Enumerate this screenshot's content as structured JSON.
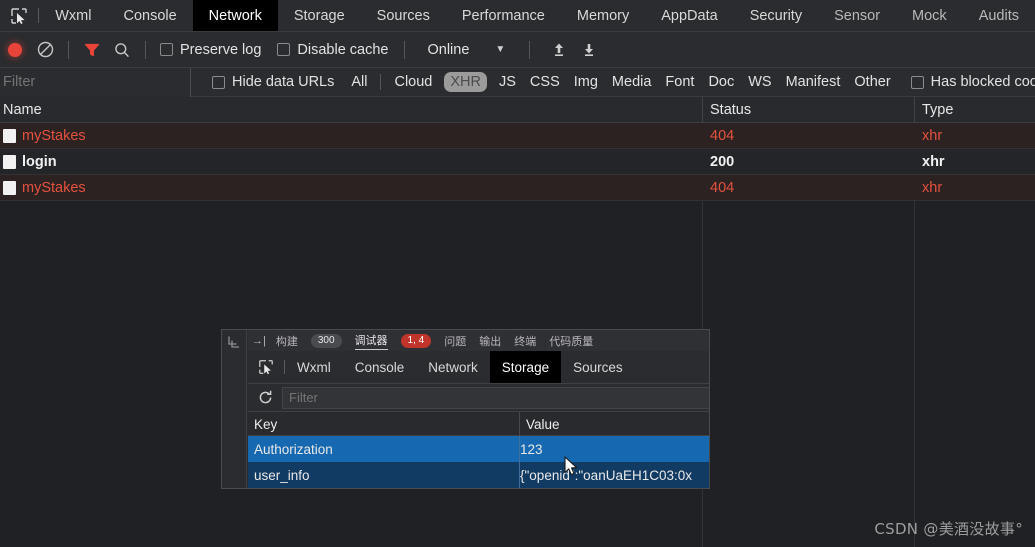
{
  "outer": {
    "inspect_icon": "inspect-element-icon",
    "tabs": [
      {
        "label": "Wxml",
        "active": false
      },
      {
        "label": "Console",
        "active": false
      },
      {
        "label": "Network",
        "active": true
      },
      {
        "label": "Storage",
        "active": false
      },
      {
        "label": "Sources",
        "active": false
      },
      {
        "label": "Performance",
        "active": false
      },
      {
        "label": "Memory",
        "active": false
      },
      {
        "label": "AppData",
        "active": false
      },
      {
        "label": "Security",
        "active": false
      },
      {
        "label": "Sensor",
        "active": false
      },
      {
        "label": "Mock",
        "active": false
      },
      {
        "label": "Audits",
        "active": false
      }
    ],
    "toolbar": {
      "record_icon": "record-icon",
      "clear_icon": "clear-icon",
      "filter_icon": "filter-funnel-icon",
      "search_icon": "search-icon",
      "preserve_log_label": "Preserve log",
      "preserve_log_checked": false,
      "disable_cache_label": "Disable cache",
      "disable_cache_checked": false,
      "throttle_value": "Online",
      "caret_icon": "chevron-down-icon",
      "import_icon": "import-har-icon",
      "export_icon": "export-har-icon"
    },
    "filterbar": {
      "filter_placeholder": "Filter",
      "filter_value": "",
      "hide_data_urls_label": "Hide data URLs",
      "hide_data_urls_checked": false,
      "types": [
        {
          "label": "All",
          "selected": false
        },
        {
          "label": "Cloud",
          "selected": false
        },
        {
          "label": "XHR",
          "selected": true
        },
        {
          "label": "JS",
          "selected": false
        },
        {
          "label": "CSS",
          "selected": false
        },
        {
          "label": "Img",
          "selected": false
        },
        {
          "label": "Media",
          "selected": false
        },
        {
          "label": "Font",
          "selected": false
        },
        {
          "label": "Doc",
          "selected": false
        },
        {
          "label": "WS",
          "selected": false
        },
        {
          "label": "Manifest",
          "selected": false
        },
        {
          "label": "Other",
          "selected": false
        }
      ],
      "has_blocked_cookies_label": "Has blocked cookies",
      "has_blocked_cookies_checked": false
    },
    "table": {
      "columns": [
        "Name",
        "Status",
        "Type"
      ],
      "rows": [
        {
          "name": "myStakes",
          "status": "404",
          "type": "xhr",
          "error": true
        },
        {
          "name": "login",
          "status": "200",
          "type": "xhr",
          "error": false
        },
        {
          "name": "myStakes",
          "status": "404",
          "type": "xhr",
          "error": true
        }
      ]
    }
  },
  "inner": {
    "gutter_icon": "panel-collapse-icon",
    "toprow": {
      "arrow_icon": "sidebar-toggle-icon",
      "items": [
        {
          "label": "构建",
          "badge": "300",
          "badge_kind": "gray",
          "active": false
        },
        {
          "label": "调试器",
          "badge": "1, 4",
          "badge_kind": "red",
          "active": true
        },
        {
          "label": "问题",
          "badge": "",
          "badge_kind": "",
          "active": false
        },
        {
          "label": "输出",
          "badge": "",
          "badge_kind": "",
          "active": false
        },
        {
          "label": "终端",
          "badge": "",
          "badge_kind": "",
          "active": false
        },
        {
          "label": "代码质量",
          "badge": "",
          "badge_kind": "",
          "active": false
        }
      ]
    },
    "inspect_icon": "inspect-element-icon",
    "tabs": [
      {
        "label": "Wxml",
        "active": false
      },
      {
        "label": "Console",
        "active": false
      },
      {
        "label": "Network",
        "active": false
      },
      {
        "label": "Storage",
        "active": true
      },
      {
        "label": "Sources",
        "active": false
      }
    ],
    "refresh_icon": "refresh-icon",
    "filter_placeholder": "Filter",
    "filter_value": "",
    "storage": {
      "columns": [
        "Key",
        "Value"
      ],
      "rows": [
        {
          "key": "Authorization",
          "value": "123",
          "selected": true
        },
        {
          "key": "user_info",
          "value": "{\"openid\":\"oanUaEH1C03:0x",
          "selected": false
        }
      ]
    },
    "cursor_icon": "mouse-cursor-icon"
  },
  "watermark": "CSDN @美酒没故事°",
  "colors": {
    "error_red": "#e4513e",
    "selection_blue": "#1668b0",
    "badge_red": "#c0352b",
    "record_red": "#e8443a"
  }
}
